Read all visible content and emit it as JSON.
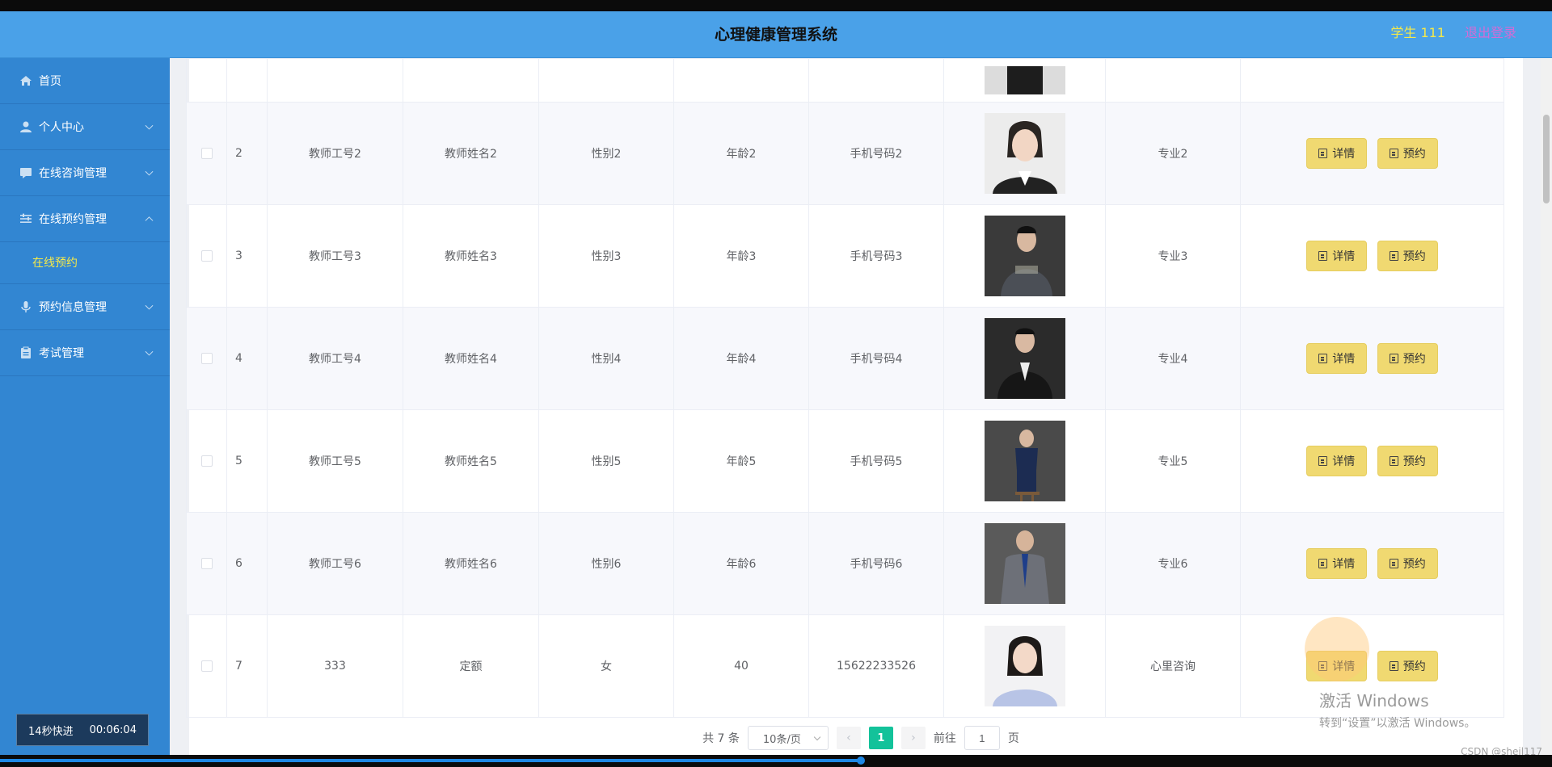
{
  "header": {
    "title": "心理健康管理系统",
    "user": "学生 111",
    "logout": "退出登录"
  },
  "sidebar": {
    "items": [
      {
        "label": "首页",
        "icon": "home-icon"
      },
      {
        "label": "个人中心",
        "icon": "user-icon"
      },
      {
        "label": "在线咨询管理",
        "icon": "chat-icon"
      },
      {
        "label": "在线预约管理",
        "icon": "sliders-icon",
        "expanded": true
      },
      {
        "label": "预约信息管理",
        "icon": "mic-icon"
      },
      {
        "label": "考试管理",
        "icon": "clipboard-icon"
      }
    ],
    "subitem": "在线预约"
  },
  "speed_badge": {
    "mode": "14秒快进",
    "time": "00:06:04"
  },
  "table": {
    "rows": [
      {
        "index": "2",
        "id": "教师工号2",
        "name": "教师姓名2",
        "gender": "性别2",
        "age": "年龄2",
        "phone": "手机号码2",
        "major": "专业2"
      },
      {
        "index": "3",
        "id": "教师工号3",
        "name": "教师姓名3",
        "gender": "性别3",
        "age": "年龄3",
        "phone": "手机号码3",
        "major": "专业3"
      },
      {
        "index": "4",
        "id": "教师工号4",
        "name": "教师姓名4",
        "gender": "性别4",
        "age": "年龄4",
        "phone": "手机号码4",
        "major": "专业4"
      },
      {
        "index": "5",
        "id": "教师工号5",
        "name": "教师姓名5",
        "gender": "性别5",
        "age": "年龄5",
        "phone": "手机号码5",
        "major": "专业5"
      },
      {
        "index": "6",
        "id": "教师工号6",
        "name": "教师姓名6",
        "gender": "性别6",
        "age": "年龄6",
        "phone": "手机号码6",
        "major": "专业6"
      },
      {
        "index": "7",
        "id": "333",
        "name": "定额",
        "gender": "女",
        "age": "40",
        "phone": "15622233526",
        "major": "心里咨询"
      }
    ],
    "detail_label": "详情",
    "book_label": "预约"
  },
  "pager": {
    "total": "共 7 条",
    "page_size": "10条/页",
    "current": "1",
    "goto_prefix": "前往",
    "goto_value": "1",
    "goto_suffix": "页"
  },
  "watermark": {
    "line1": "激活 Windows",
    "line2": "转到“设置”以激活 Windows。"
  },
  "credit": "CSDN @shejl117",
  "colors": {
    "header": "#4aa1e8",
    "sidebar": "#3286d2",
    "button": "#f0d971",
    "active_page": "#13c29a",
    "highlight_text": "#f5e94a"
  }
}
